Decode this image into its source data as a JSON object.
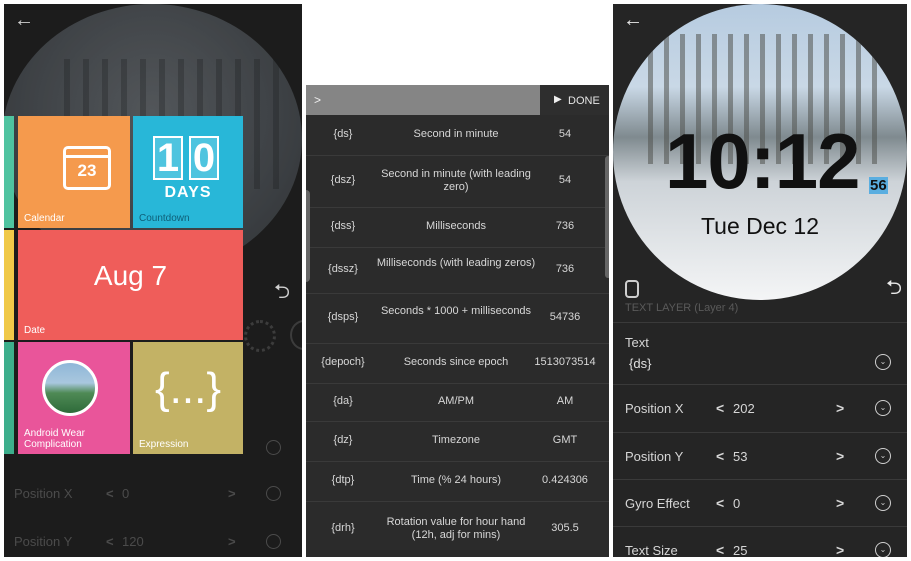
{
  "panel_left": {
    "tiles": [
      {
        "label": "Calendar",
        "icon_text": "23",
        "color": "#f59a4d"
      },
      {
        "label": "Countdown",
        "digits": [
          "1",
          "0"
        ],
        "unit": "DAYS",
        "color": "#28b7d8"
      },
      {
        "label": "Date",
        "big_text": "Aug 7",
        "color": "#ef5d5a"
      },
      {
        "label": "Android Wear Complication",
        "color": "#e9559a"
      },
      {
        "label": "Expression",
        "symbol": "{...}",
        "color": "#c3b265"
      }
    ],
    "strip_colors": [
      "#4fc3a0",
      "#f0c948",
      "#3cae8c"
    ],
    "faded_rows": [
      {
        "label": "Position X",
        "arrow": "<",
        "value": "0",
        "next": ">"
      },
      {
        "label": "Position Y",
        "arrow": "<",
        "value": "120",
        "next": ">"
      }
    ],
    "icons": {
      "back": "back-arrow-icon",
      "undo": "undo-icon",
      "gear": "gear-icon"
    }
  },
  "panel_middle": {
    "input_prompt": ">",
    "done_label": "DONE",
    "rows": [
      {
        "tag": "{ds}",
        "desc": "Second in minute",
        "value": "54"
      },
      {
        "tag": "{dsz}",
        "desc": "Second in minute (with leading zero)",
        "value": "54"
      },
      {
        "tag": "{dss}",
        "desc": "Milliseconds",
        "value": "736"
      },
      {
        "tag": "{dssz}",
        "desc": "Milliseconds (with leading zeros)",
        "value": "736"
      },
      {
        "tag": "{dsps}",
        "desc": "Seconds * 1000 + milliseconds",
        "value": "54736"
      },
      {
        "tag": "{depoch}",
        "desc": "Seconds since epoch",
        "value": "1513073514"
      },
      {
        "tag": "{da}",
        "desc": "AM/PM",
        "value": "AM"
      },
      {
        "tag": "{dz}",
        "desc": "Timezone",
        "value": "GMT"
      },
      {
        "tag": "{dtp}",
        "desc": "Time (% 24 hours)",
        "value": "0.424306"
      },
      {
        "tag": "{drh}",
        "desc": "Rotation value for hour hand (12h, adj for mins)",
        "value": "305.5"
      }
    ]
  },
  "panel_right": {
    "watch": {
      "time": "10:12",
      "seconds": "56",
      "date": "Tue Dec 12"
    },
    "section_label": "TEXT LAYER (Layer 4)",
    "text_label": "Text",
    "text_value": "{ds}",
    "properties": [
      {
        "label": "Position X",
        "value": "202"
      },
      {
        "label": "Position Y",
        "value": "53"
      },
      {
        "label": "Gyro Effect",
        "value": "0"
      },
      {
        "label": "Text Size",
        "value": "25"
      }
    ]
  }
}
